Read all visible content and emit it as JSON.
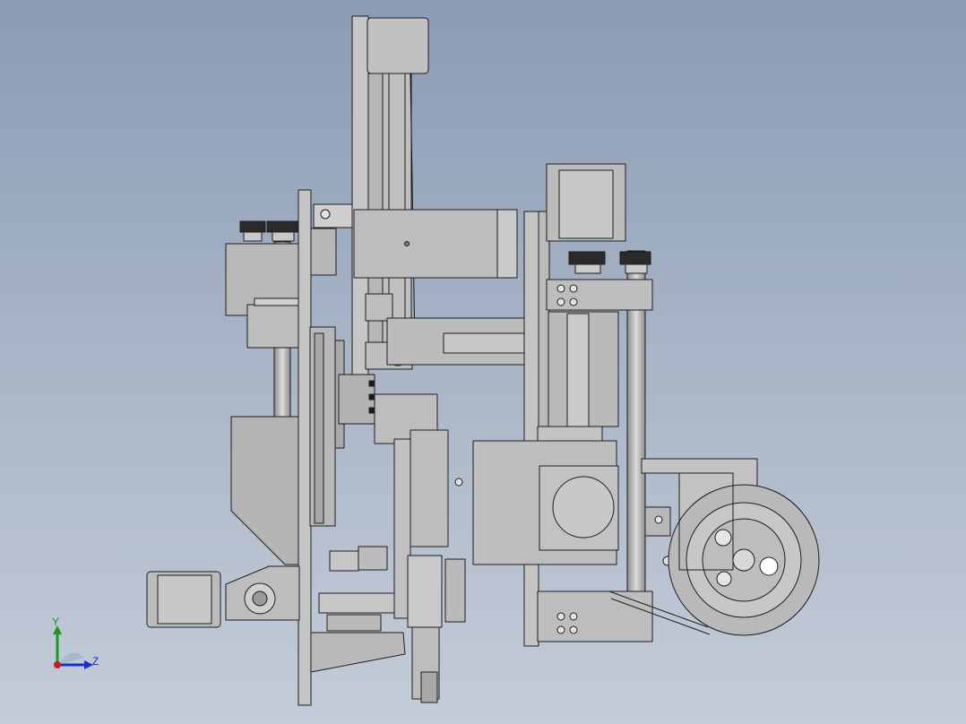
{
  "viewport": {
    "background_top": "#8a9bb3",
    "background_bottom": "#c4ccd8",
    "part_fill": "#bdbdbd",
    "part_dark": "#9a9a9a",
    "edge_color": "#1e1e1e"
  },
  "triad": {
    "y_label": "Y",
    "z_label": "Z",
    "y_color": "#1a9a1a",
    "z_color": "#1a2fd0",
    "x_color": "#c81e1e"
  },
  "model": {
    "description_icon": "cad-assembly-model",
    "wheel_icon": "drive-wheel-icon",
    "motor_icon": "stepper-motor-icon"
  }
}
